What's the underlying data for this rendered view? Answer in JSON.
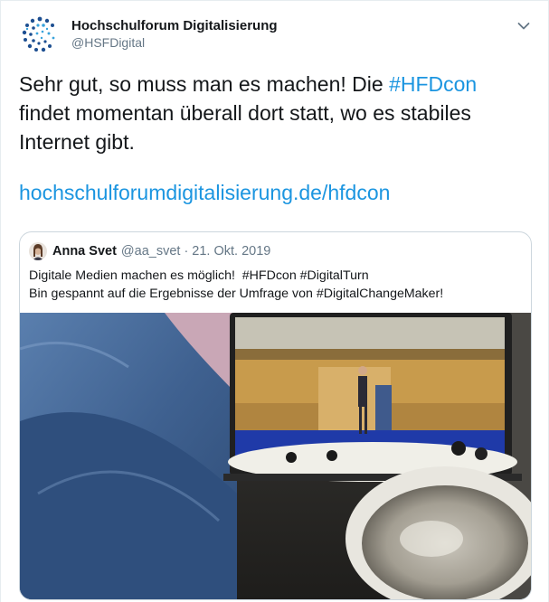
{
  "author": {
    "name": "Hochschulforum Digitalisierung",
    "handle": "@HSFDigital"
  },
  "tweet": {
    "text_before": "Sehr gut, so muss man es machen! Die ",
    "hashtag": "#HFDcon",
    "text_after": " findet momentan überall dort statt, wo es stabiles Internet gibt.",
    "link": "hochschulforumdigitalisierung.de/hfdcon"
  },
  "quoted": {
    "name": "Anna Svet",
    "handle": "@aa_svet",
    "separator": "·",
    "date": "21. Okt. 2019",
    "line1": "Digitale Medien machen es möglich!  #HFDcon #DigitalTurn",
    "line2": "Bin gespannt auf die Ergebnisse der Umfrage von #DigitalChangeMaker!"
  },
  "colors": {
    "link": "#1b95e0",
    "muted": "#657786",
    "border": "#ccd6dd"
  },
  "icons": [
    "hsf-logo-icon",
    "chevron-down-icon"
  ]
}
